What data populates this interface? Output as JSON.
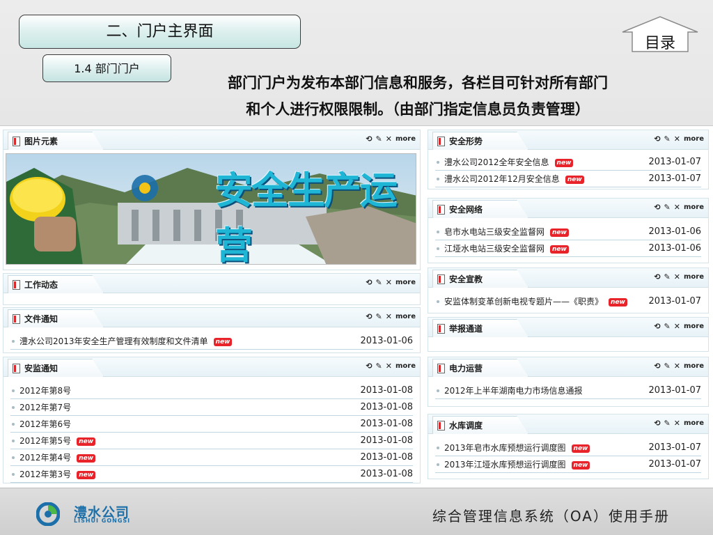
{
  "header": {
    "section_title": "二、门户主界面",
    "subsection_title": "1.4  部门门户",
    "toc_label": "目录",
    "description_line1": "部门门户为发布本部门信息和服务，各栏目可针对所有部门",
    "description_line2": "和个人进行权限限制。（由部门指定信息员负责管理）"
  },
  "tools": {
    "refresh": "⟲",
    "edit": "✎",
    "close": "✕",
    "more": "more"
  },
  "badge_text": "new",
  "banner": {
    "text": "安全生产运营"
  },
  "panels": {
    "pictures": {
      "title": "图片元素"
    },
    "work_news": {
      "title": "工作动态"
    },
    "file_notices": {
      "title": "文件通知",
      "rows": [
        {
          "text": "澧水公司2013年安全生产管理有效制度和文件清单",
          "date": "2013-01-06"
        }
      ]
    },
    "safety_notices": {
      "title": "安监通知",
      "rows": [
        {
          "text": "2012年第8号",
          "date": "2013-01-08"
        },
        {
          "text": "2012年第7号",
          "date": "2013-01-08"
        },
        {
          "text": "2012年第6号",
          "date": "2013-01-08"
        },
        {
          "text": "2012年第5号",
          "date": "2013-01-08"
        },
        {
          "text": "2012年第4号",
          "date": "2013-01-08"
        },
        {
          "text": "2012年第3号",
          "date": "2013-01-08"
        }
      ]
    },
    "safety_situation": {
      "title": "安全形势",
      "rows": [
        {
          "text": "澧水公司2012全年安全信息",
          "date": "2013-01-07"
        },
        {
          "text": "澧水公司2012年12月安全信息",
          "date": "2013-01-07"
        }
      ]
    },
    "safety_network": {
      "title": "安全网络",
      "rows": [
        {
          "text": "皂市水电站三级安全监督网",
          "date": "2013-01-06"
        },
        {
          "text": "江垭水电站三级安全监督网",
          "date": "2013-01-06"
        }
      ]
    },
    "safety_education": {
      "title": "安全宣教",
      "rows": [
        {
          "text": "安监体制变革创新电视专题片——《职责》",
          "date": "2013-01-07"
        }
      ]
    },
    "report_channel": {
      "title": "举报通道"
    },
    "power_operation": {
      "title": "电力运营",
      "rows": [
        {
          "text": "2012年上半年湖南电力市场信息通报",
          "date": "2013-01-07"
        }
      ]
    },
    "reservoir_dispatch": {
      "title": "水库调度",
      "rows": [
        {
          "text": "2013年皂市水库预想运行调度图",
          "date": "2013-01-07"
        },
        {
          "text": "2013年江垭水库预想运行调度图",
          "date": "2013-01-07"
        }
      ]
    }
  },
  "footer": {
    "brand_cn": "澧水公司",
    "brand_en": "LISHUI GONGSI",
    "title": "综合管理信息系统（OA）使用手册"
  },
  "colors": {
    "accent_blue": "#1c6fa8",
    "badge_red": "#e8242a",
    "panel_border": "#d4e3ea"
  }
}
